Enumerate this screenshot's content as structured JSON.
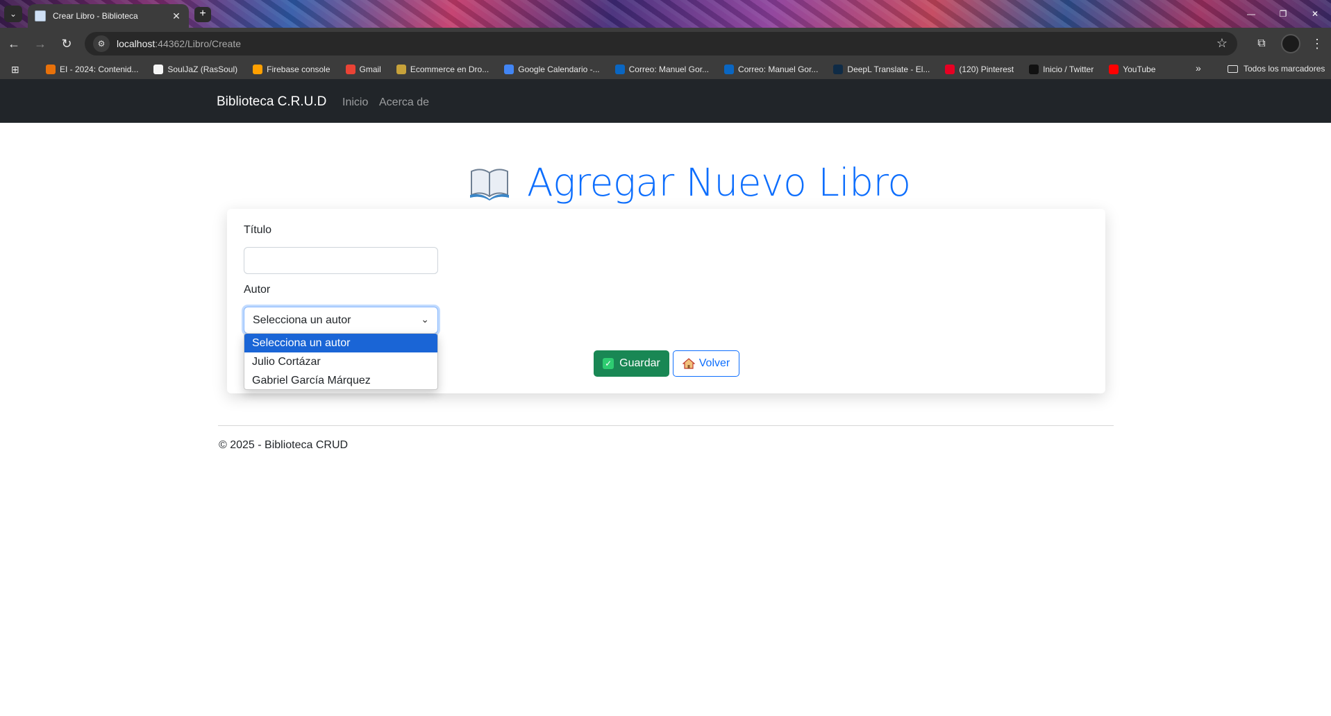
{
  "browser": {
    "tab_title": "Crear Libro - Biblioteca",
    "url_host": "localhost",
    "url_path": ":44362/Libro/Create",
    "bookmarks": [
      {
        "label": "EI - 2024: Contenid...",
        "color": "#e8710a"
      },
      {
        "label": "SoulJaZ (RasSoul)",
        "color": "#f5f5f5"
      },
      {
        "label": "Firebase console",
        "color": "#ffa000"
      },
      {
        "label": "Gmail",
        "color": "#ea4335"
      },
      {
        "label": "Ecommerce en Dro...",
        "color": "#c7a23a"
      },
      {
        "label": "Google Calendario -...",
        "color": "#4285f4"
      },
      {
        "label": "Correo: Manuel Gor...",
        "color": "#0a66c2"
      },
      {
        "label": "Correo: Manuel Gor...",
        "color": "#0a66c2"
      },
      {
        "label": "DeepL Translate - El...",
        "color": "#0f2b46"
      },
      {
        "label": "(120) Pinterest",
        "color": "#e60023"
      },
      {
        "label": "Inicio / Twitter",
        "color": "#111111"
      },
      {
        "label": "YouTube",
        "color": "#ff0000"
      }
    ],
    "all_bookmarks": "Todos los marcadores"
  },
  "navbar": {
    "brand": "Biblioteca C.R.U.D",
    "links": [
      "Inicio",
      "Acerca de"
    ]
  },
  "main": {
    "heading": "Agregar Nuevo Libro",
    "titulo_label": "Título",
    "titulo_value": "",
    "autor_label": "Autor",
    "autor_selected": "Selecciona un autor",
    "autor_options": [
      "Selecciona un autor",
      "Julio Cortázar",
      "Gabriel García Márquez"
    ],
    "save_label": "Guardar",
    "back_label": "Volver"
  },
  "footer": {
    "text": "© 2025 - Biblioteca CRUD"
  },
  "colors": {
    "primary": "#0d6efd",
    "success": "#198754",
    "navbar_bg": "#212529"
  }
}
